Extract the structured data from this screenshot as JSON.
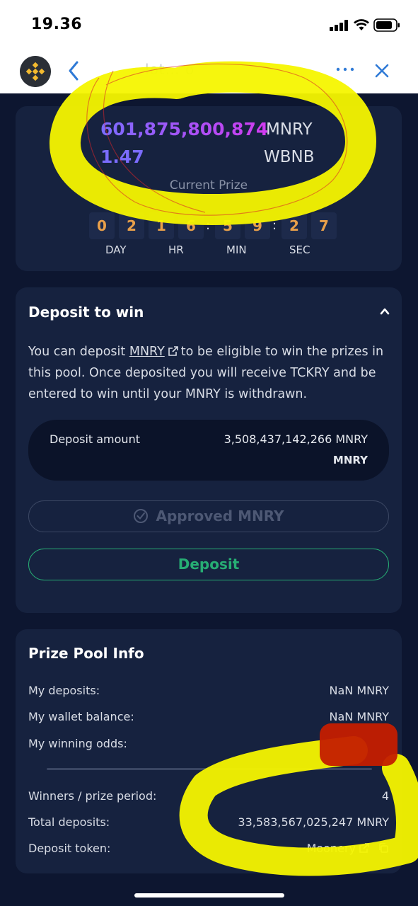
{
  "status_bar": {
    "time": "19.36"
  },
  "header": {
    "title": "lot… o",
    "more_icon": "ellipsis-icon",
    "close_icon": "close-icon",
    "back_icon": "chevron-left-icon",
    "logo": "binance-logo"
  },
  "prize": {
    "amount": "601,875,800,874",
    "amount_unit": "MNRY",
    "amount2": "1.47",
    "amount2_unit": "WBNB",
    "label": "Current Prize",
    "countdown_digits": [
      "0",
      "2",
      "1",
      "6",
      "5",
      "9",
      "2",
      "7"
    ],
    "countdown_separator": ":",
    "labels": {
      "day": "DAY",
      "hr": "HR",
      "min": "MIN",
      "sec": "SEC"
    }
  },
  "deposit": {
    "title": "Deposit to win",
    "desc_prefix": "You can deposit",
    "desc_link": "MNRY",
    "desc_suffix": "to be eligible to win the prizes in this pool. Once deposited you will receive TCKRY and be entered to win until your MNRY is withdrawn.",
    "amount_label": "Deposit amount",
    "amount_value": "3,508,437,142,266 MNRY",
    "amount_token": "MNRY",
    "approved_label": "Approved MNRY",
    "deposit_label": "Deposit"
  },
  "info": {
    "title": "Prize Pool Info",
    "rows": [
      {
        "label": "My deposits:",
        "value": "NaN  MNRY"
      },
      {
        "label": "My wallet balance:",
        "value": "NaN  MNRY"
      },
      {
        "label": "My winning odds:",
        "value": ""
      },
      {
        "label": "Winners / prize period:",
        "value": "4"
      },
      {
        "label": "Total deposits:",
        "value": "33,583,567,025,247  MNRY"
      },
      {
        "label": "Deposit token:",
        "value": "Moonery"
      }
    ]
  },
  "colors": {
    "background": "#0d1630",
    "card": "#16223f",
    "accent_green": "#27ad74",
    "countdown_digit": "#e9a04a",
    "prize_gradient_start": "#7b6cff",
    "prize_gradient_end": "#d23bf0",
    "highlighter_yellow": "#f5f500",
    "redaction_red": "#c41d00"
  }
}
